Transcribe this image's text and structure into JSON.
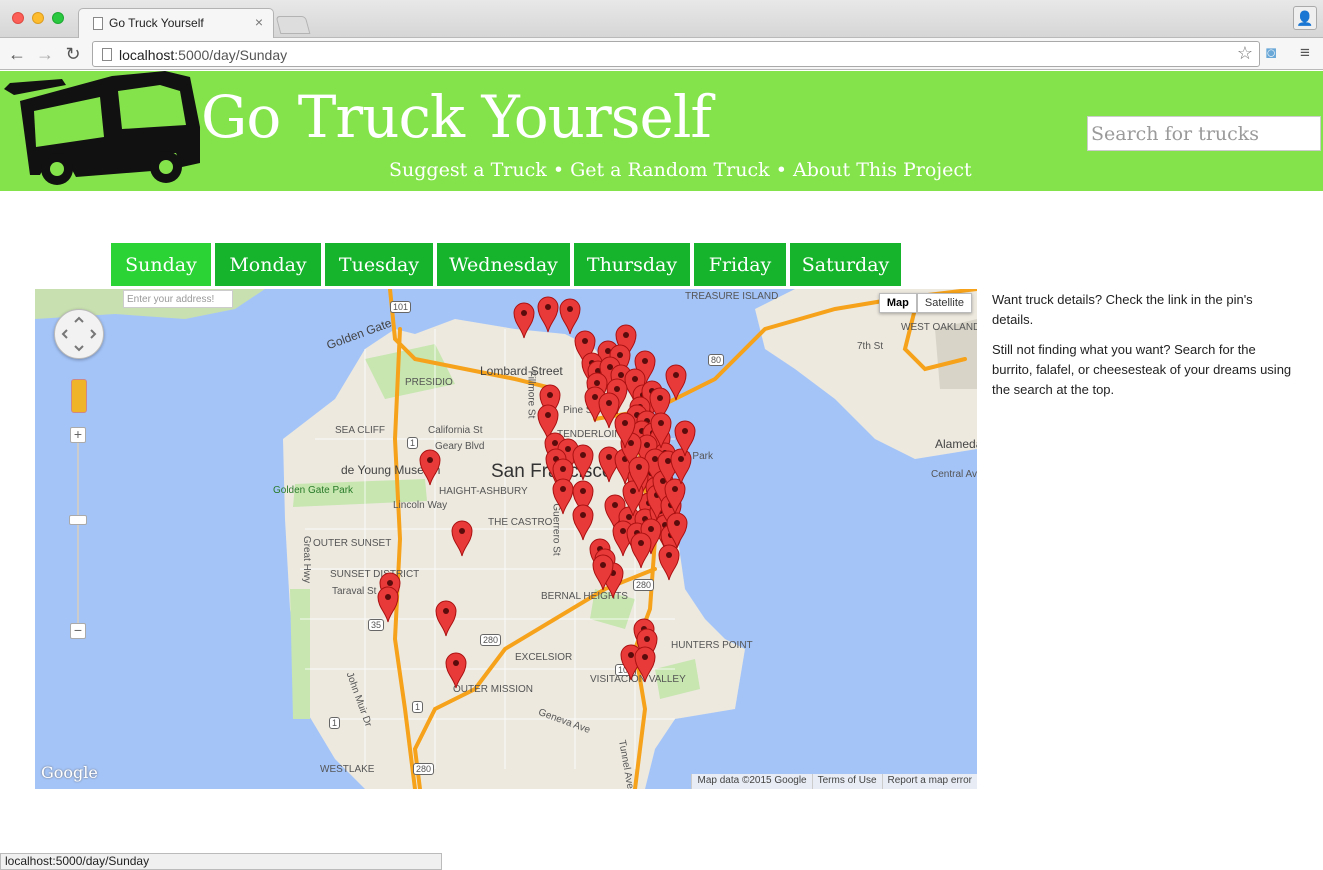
{
  "browser": {
    "tab_title": "Go Truck Yourself",
    "url_host": "localhost",
    "url_path": ":5000/day/Sunday",
    "status_url": "localhost:5000/day/Sunday"
  },
  "header": {
    "title": "Go Truck Yourself",
    "nav": [
      "Suggest a Truck",
      "Get a Random Truck",
      "About This Project"
    ],
    "nav_separator": "•",
    "search_placeholder": "Search for trucks"
  },
  "days": {
    "items": [
      "Sunday",
      "Monday",
      "Tuesday",
      "Wednesday",
      "Thursday",
      "Friday",
      "Saturday"
    ],
    "active": "Sunday"
  },
  "map": {
    "address_placeholder": "Enter your address!",
    "type_map": "Map",
    "type_satellite": "Satellite",
    "logo": "Google",
    "footer": [
      "Map data ©2015 Google",
      "Terms of Use",
      "Report a map error"
    ],
    "places": [
      "Golden Gate",
      "PRESIDIO",
      "Lombard Street",
      "SEA CLIFF",
      "California St",
      "Geary Blvd",
      "de Young Museum",
      "San Francisco",
      "AT&T Park",
      "Golden Gate Park",
      "HAIGHT-ASHBURY",
      "Lincoln Way",
      "THE CASTRO",
      "OUTER SUNSET",
      "SUNSET DISTRICT",
      "Taraval St",
      "BERNAL HEIGHTS",
      "EXCELSIOR",
      "HUNTERS POINT",
      "VISITACION VALLEY",
      "WESTLAKE",
      "Geneva Ave",
      "WEST OAKLAND",
      "Alameda Island",
      "TREASURE ISLAND",
      "Fillmore St",
      "Guerrero St",
      "Great Hwy",
      "John Muir Dr",
      "Pine St",
      "TENDERLOIN",
      "7th St",
      "Central Ave",
      "Tunnel Ave",
      "OUTER MISSION"
    ],
    "highways": [
      "101",
      "80",
      "280",
      "1",
      "35"
    ],
    "pin_count": 86
  },
  "side": {
    "p1": "Want truck details? Check the link in the pin's details.",
    "p2": "Still not finding what you want? Search for the burrito, falafel, or cheesesteak of your dreams using the search at the top."
  },
  "colors": {
    "header_green": "#84e34b",
    "day_tab": "#16b42c",
    "day_tab_active": "#2bd335",
    "pin_red": "#e93a3a",
    "water": "#a4c4f8"
  }
}
